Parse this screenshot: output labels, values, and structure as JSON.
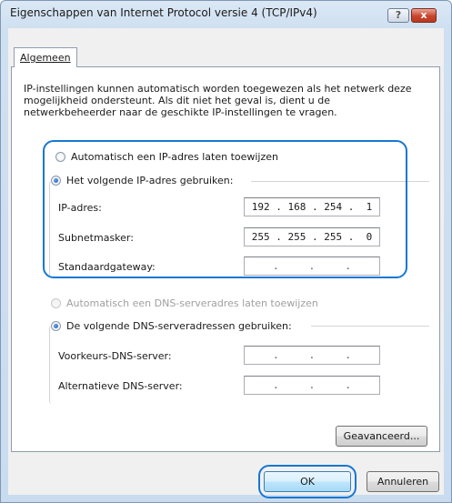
{
  "window": {
    "title": "Eigenschappen van Internet Protocol versie 4 (TCP/IPv4)",
    "help_label": "?",
    "close_label": "x"
  },
  "tab": {
    "label": "Algemeen"
  },
  "intro": "IP-instellingen kunnen automatisch worden toegewezen als het netwerk deze mogelijkheid ondersteunt. Als dit niet het geval is, dient u de netwerkbeheerder naar de geschikte IP-instellingen te vragen.",
  "ip_section": {
    "auto_label": "Automatisch een IP-adres laten toewijzen",
    "auto_selected": false,
    "manual_label": "Het volgende IP-adres gebruiken:",
    "manual_selected": true,
    "fields": [
      {
        "label": "IP-adres:",
        "value": "192 . 168 . 254 .  1"
      },
      {
        "label": "Subnetmasker:",
        "value": "255 . 255 . 255 .  0"
      },
      {
        "label": "Standaardgateway:",
        "value": "    .     .     .    "
      }
    ]
  },
  "dns_section": {
    "auto_label": "Automatisch een DNS-serveradres laten toewijzen",
    "auto_enabled": false,
    "manual_label": "De volgende DNS-serveradressen gebruiken:",
    "manual_selected": true,
    "fields": [
      {
        "label": "Voorkeurs-DNS-server:",
        "value": "    .     .     .    "
      },
      {
        "label": "Alternatieve DNS-server:",
        "value": "    .     .     .    "
      }
    ]
  },
  "buttons": {
    "advanced": "Geavanceerd...",
    "ok": "OK",
    "cancel": "Annuleren"
  },
  "colors": {
    "highlight": "#1677d2",
    "title_bar": "#cfe0f1",
    "close_button": "#c9452d"
  }
}
